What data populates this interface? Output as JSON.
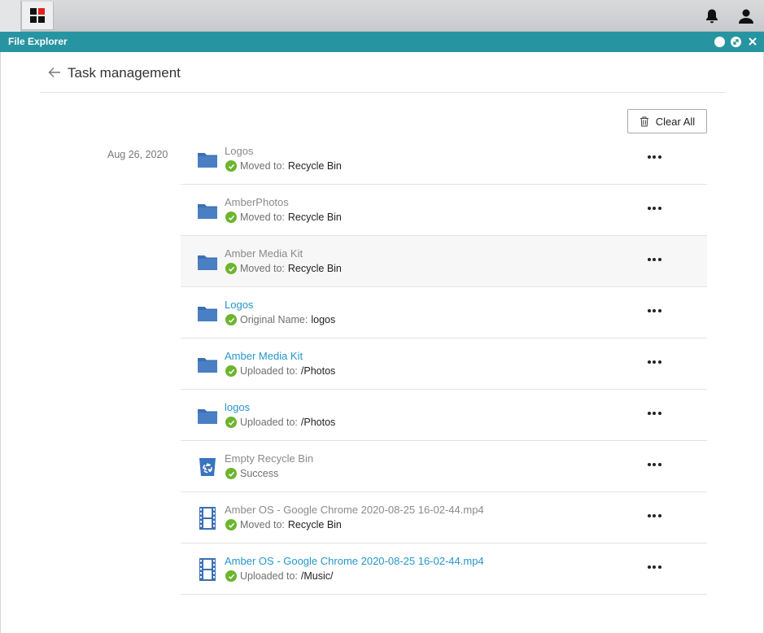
{
  "window": {
    "title": "File Explorer"
  },
  "page": {
    "title": "Task management",
    "clear_all_label": "Clear All"
  },
  "date_group": "Aug 26, 2020",
  "colors": {
    "titlebar": "#2794a1",
    "link": "#2596c9",
    "success": "#6cb52d",
    "folder": "#3b6fb6"
  },
  "tasks": [
    {
      "icon": "folder-icon",
      "name": "Logos",
      "name_is_link": false,
      "status_label": "Moved to:",
      "status_value": "Recycle Bin"
    },
    {
      "icon": "folder-icon",
      "name": "AmberPhotos",
      "name_is_link": false,
      "status_label": "Moved to:",
      "status_value": "Recycle Bin"
    },
    {
      "icon": "folder-icon",
      "name": "Amber Media Kit",
      "name_is_link": false,
      "status_label": "Moved to:",
      "status_value": "Recycle Bin"
    },
    {
      "icon": "folder-icon",
      "name": "Logos",
      "name_is_link": true,
      "status_label": "Original Name:",
      "status_value": "logos"
    },
    {
      "icon": "folder-icon",
      "name": "Amber Media Kit",
      "name_is_link": true,
      "status_label": "Uploaded to:",
      "status_value": "/Photos"
    },
    {
      "icon": "folder-icon",
      "name": "logos",
      "name_is_link": true,
      "status_label": "Uploaded to:",
      "status_value": "/Photos"
    },
    {
      "icon": "recycle-bin-icon",
      "name": "Empty Recycle Bin",
      "name_is_link": false,
      "status_label": "Success",
      "status_value": ""
    },
    {
      "icon": "video-file-icon",
      "name": "Amber OS - Google Chrome 2020-08-25 16-02-44.mp4",
      "name_is_link": false,
      "status_label": "Moved to:",
      "status_value": "Recycle Bin"
    },
    {
      "icon": "video-file-icon",
      "name": "Amber OS - Google Chrome 2020-08-25 16-02-44.mp4",
      "name_is_link": true,
      "status_label": "Uploaded to:",
      "status_value": "/Music/"
    }
  ]
}
